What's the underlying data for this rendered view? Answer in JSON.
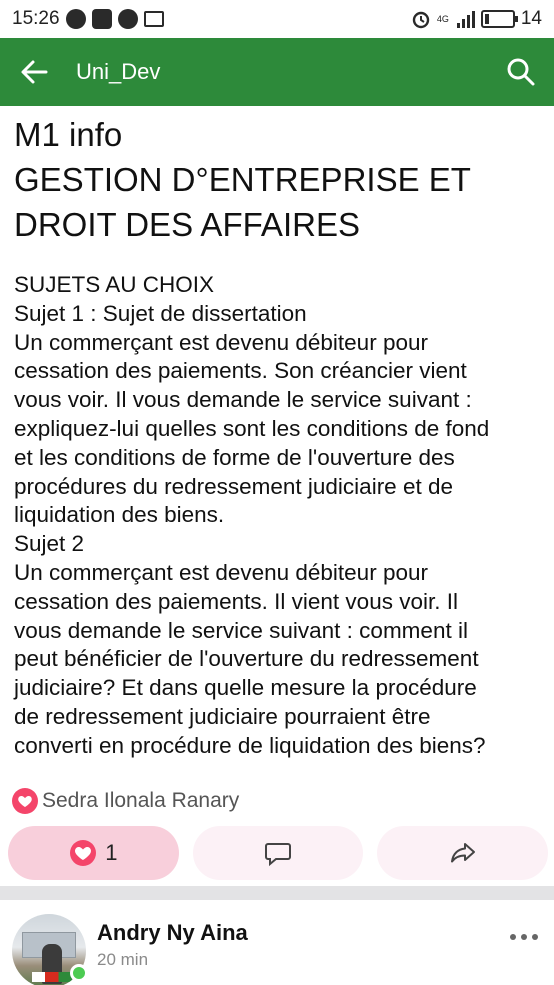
{
  "status_bar": {
    "time": "15:26",
    "network_label": "4G",
    "battery": "14"
  },
  "app_bar": {
    "title": "Uni_Dev"
  },
  "post": {
    "title": "M1 info\nGESTION D°ENTREPRISE ET\nDROIT DES AFFAIRES",
    "body_lines": [
      " SUJETS AU CHOIX",
      "Sujet 1 : Sujet de dissertation",
      "Un commerçant est devenu débiteur pour",
      "cessation des paiements. Son créancier vient",
      "vous voir. Il vous demande le service suivant :",
      "expliquez-lui quelles sont les conditions de fond",
      "et les conditions de forme de l'ouverture des",
      "procédures du redressement judiciaire et de",
      "liquidation des biens.",
      "Sujet 2",
      "Un commerçant est devenu débiteur pour",
      "cessation des paiements. Il vient vous voir. Il",
      "vous demande le service suivant : comment il",
      "peut bénéficier de l'ouverture du redressement",
      "judiciaire? Et dans quelle mesure la procédure",
      "de redressement judiciaire pourraient être",
      "converti en procédure de liquidation des biens?"
    ],
    "reactor_name": "Sedra Ilonala Ranary",
    "like_count": "1"
  },
  "next_post": {
    "author": "Andry Ny Aina",
    "time": "20 min"
  },
  "colors": {
    "app_bar": "#2d8a3a",
    "like_pill": "#f8cfdb",
    "heart": "#f4456a",
    "online": "#4ccb52"
  },
  "icons": {
    "back": "arrow-left-icon",
    "search": "search-icon",
    "like": "heart-icon",
    "comment": "comment-icon",
    "share": "share-icon",
    "more": "more-horizontal-icon"
  }
}
